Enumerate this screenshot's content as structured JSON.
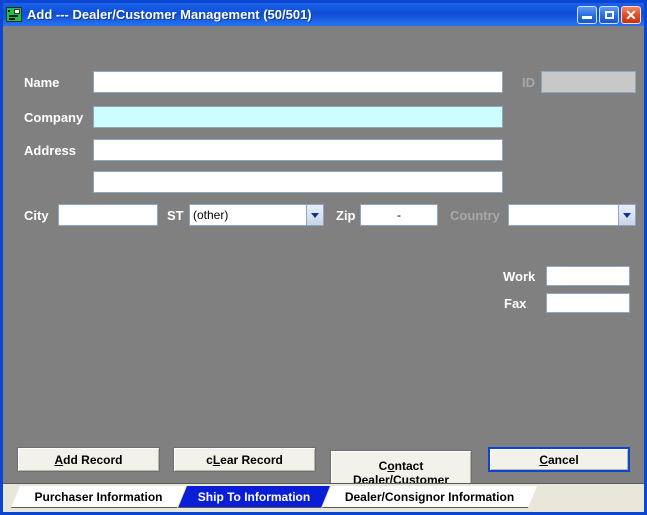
{
  "window": {
    "title": "Add --- Dealer/Customer Management (50/501)",
    "icon": "form-record-icon",
    "controls": {
      "minimize": "minimize-icon",
      "maximize": "maximize-icon",
      "close": "close-icon"
    },
    "border_color": "#0a46d2",
    "titlebar_color": "#0f4fd8",
    "client_bg": "#808080"
  },
  "form": {
    "fields": [
      {
        "label": "Name",
        "value": "",
        "state": "normal"
      },
      {
        "label": "Company",
        "value": "",
        "state": "focused"
      },
      {
        "label": "Address",
        "value": "",
        "state": "normal"
      },
      {
        "label": "",
        "value": "",
        "state": "normal"
      }
    ],
    "id": {
      "label": "ID",
      "value": "",
      "state": "disabled"
    },
    "city": {
      "label": "City",
      "value": ""
    },
    "state_select": {
      "label": "ST",
      "selected": "(other)",
      "icon": "chevron-down-icon"
    },
    "zip": {
      "label": "Zip",
      "value": "-"
    },
    "country_select": {
      "label": "Country",
      "selected": "",
      "state": "disabled",
      "icon": "chevron-down-icon"
    },
    "work": {
      "label": "Work",
      "value": ""
    },
    "fax": {
      "label": "Fax",
      "value": ""
    }
  },
  "buttons": {
    "add_record": {
      "pre": "",
      "mnemonic": "A",
      "post": "dd Record"
    },
    "clear_record": {
      "pre": "c",
      "mnemonic": "L",
      "post": "ear Record"
    },
    "contact_line1_pre": "C",
    "contact_line1_mnemonic": "o",
    "contact_line1_post": "ntact",
    "contact_line2": "Dealer/Customer",
    "cancel": {
      "pre": "",
      "mnemonic": "C",
      "post": "ancel",
      "focused": true
    }
  },
  "tabs": {
    "items": [
      {
        "label": "Purchaser Information",
        "active": false
      },
      {
        "label": "Ship To Information",
        "active": true
      },
      {
        "label": "Dealer/Consignor Information",
        "active": false
      }
    ],
    "active_color": "#0a1ed8",
    "strip_bg": "#e9e6da"
  }
}
